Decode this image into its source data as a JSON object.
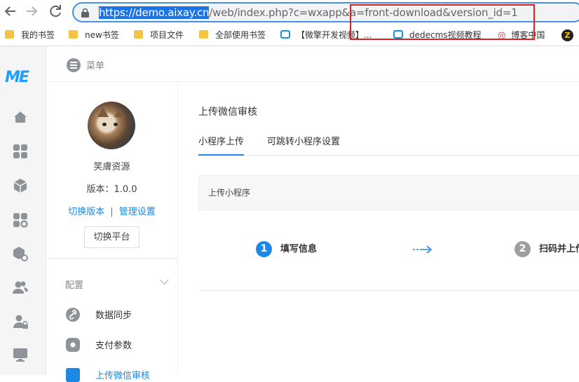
{
  "browser": {
    "url_host": "https://demo.aixay.cn",
    "url_path": "/web/index.php?c=wxapp&a=front-download&version_id=1",
    "bookmarks": [
      {
        "label": "我的书签",
        "icon": "folder-icon"
      },
      {
        "label": "new书签",
        "icon": "folder-icon"
      },
      {
        "label": "项目文件",
        "icon": "folder-icon"
      },
      {
        "label": "全部使用书签",
        "icon": "folder-icon"
      },
      {
        "label": "【微擎开发视频】...",
        "icon": "bilibili-tv-icon"
      },
      {
        "label": "dedecms视频教程",
        "icon": "bilibili-tv-icon"
      },
      {
        "label": "博客中国",
        "icon": "swirl-logo-icon"
      },
      {
        "label": "Z",
        "icon": "z-logo-icon"
      }
    ],
    "highlight_color": "#e02020"
  },
  "app": {
    "logo_text": "ME",
    "menu_label": "菜单",
    "profile": {
      "name": "笑膚资源",
      "version": "版本：1.0.0",
      "switch_version": "切换版本",
      "separator": "|",
      "manage_settings": "管理设置",
      "switch_platform": "切换平台"
    },
    "section_label": "配置",
    "menu_items": [
      {
        "label": "数据同步",
        "icon": "link-icon"
      },
      {
        "label": "支付参数",
        "icon": "gear-icon"
      },
      {
        "label": "上传微信审核",
        "icon": "shield-icon",
        "active": true
      }
    ],
    "content": {
      "title": "上传微信审核",
      "tabs": [
        "小程序上传",
        "可跳转小程序设置"
      ],
      "card_title": "上传小程序",
      "steps": [
        {
          "num": "1",
          "label": "填写信息"
        },
        {
          "num": "2",
          "label": "扫码并上传"
        }
      ]
    },
    "accent_color": "#1e88e5"
  }
}
